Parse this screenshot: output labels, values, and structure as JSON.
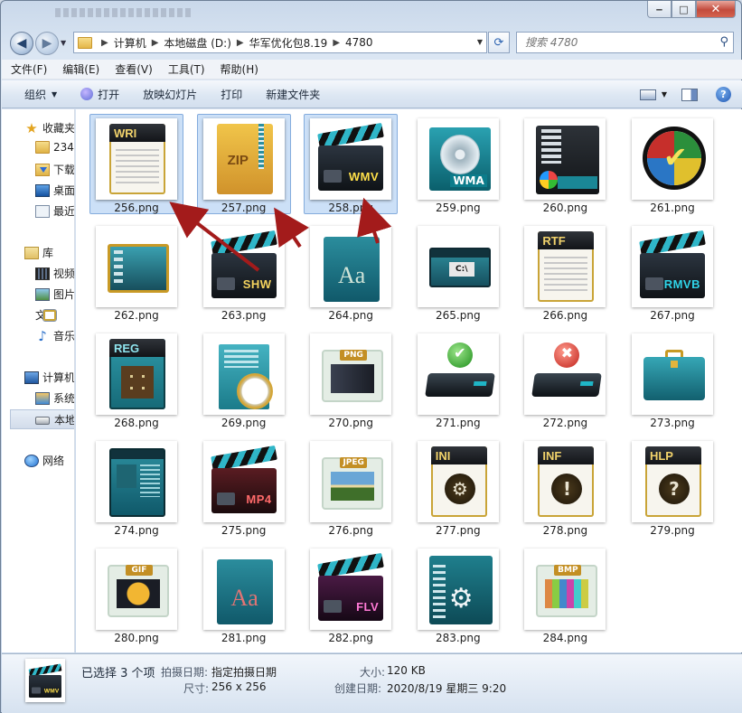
{
  "window": {
    "controls": {
      "minimize": "‒",
      "maximize": "□",
      "close": "✕"
    }
  },
  "address": {
    "crumbs": [
      "计算机",
      "本地磁盘 (D:)",
      "华军优化包8.19",
      "4780"
    ],
    "search_placeholder": "搜索 4780"
  },
  "menu": [
    "文件(F)",
    "编辑(E)",
    "查看(V)",
    "工具(T)",
    "帮助(H)"
  ],
  "toolbar": {
    "organize": "组织",
    "open": "打开",
    "slideshow": "放映幻灯片",
    "print": "打印",
    "new_folder": "新建文件夹"
  },
  "sidebar": {
    "favorites": "收藏夹",
    "fav_items": [
      "234",
      "下载",
      "桌面",
      "最近"
    ],
    "library": "库",
    "lib_items": [
      "视频",
      "图片",
      "文档",
      "音乐"
    ],
    "computer": "计算机",
    "comp_items": [
      "系统",
      "本地"
    ],
    "network": "网络"
  },
  "files": [
    {
      "name": "256.png",
      "icon": "wri-document-icon",
      "selected": true
    },
    {
      "name": "257.png",
      "icon": "zip-archive-icon",
      "selected": true
    },
    {
      "name": "258.png",
      "icon": "wmv-clapper-icon",
      "selected": true
    },
    {
      "name": "259.png",
      "icon": "wma-disc-icon",
      "selected": false
    },
    {
      "name": "260.png",
      "icon": "windows-panel-icon",
      "selected": false
    },
    {
      "name": "261.png",
      "icon": "checkmark-ball-icon",
      "selected": false
    },
    {
      "name": "262.png",
      "icon": "desktop-window-icon",
      "selected": false
    },
    {
      "name": "263.png",
      "icon": "shw-clapper-icon",
      "selected": false
    },
    {
      "name": "264.png",
      "icon": "font-file-icon",
      "selected": false
    },
    {
      "name": "265.png",
      "icon": "command-prompt-icon",
      "selected": false
    },
    {
      "name": "266.png",
      "icon": "rtf-document-icon",
      "selected": false
    },
    {
      "name": "267.png",
      "icon": "rmvb-clapper-icon",
      "selected": false
    },
    {
      "name": "268.png",
      "icon": "reg-document-icon",
      "selected": false
    },
    {
      "name": "269.png",
      "icon": "clock-document-icon",
      "selected": false
    },
    {
      "name": "270.png",
      "icon": "png-image-icon",
      "selected": false
    },
    {
      "name": "271.png",
      "icon": "drive-ok-icon",
      "selected": false
    },
    {
      "name": "272.png",
      "icon": "drive-error-icon",
      "selected": false
    },
    {
      "name": "273.png",
      "icon": "briefcase-icon",
      "selected": false
    },
    {
      "name": "274.png",
      "icon": "teal-document-icon",
      "selected": false
    },
    {
      "name": "275.png",
      "icon": "mp4-clapper-icon",
      "selected": false
    },
    {
      "name": "276.png",
      "icon": "jpeg-image-icon",
      "selected": false
    },
    {
      "name": "277.png",
      "icon": "ini-settings-icon",
      "selected": false
    },
    {
      "name": "278.png",
      "icon": "inf-info-icon",
      "selected": false
    },
    {
      "name": "279.png",
      "icon": "hlp-help-icon",
      "selected": false
    },
    {
      "name": "280.png",
      "icon": "gif-image-icon",
      "selected": false
    },
    {
      "name": "281.png",
      "icon": "font-file-red-icon",
      "selected": false
    },
    {
      "name": "282.png",
      "icon": "flv-clapper-icon",
      "selected": false
    },
    {
      "name": "283.png",
      "icon": "settings-panel-icon",
      "selected": false
    },
    {
      "name": "284.png",
      "icon": "bmp-image-icon",
      "selected": false
    }
  ],
  "labels": {
    "wri": "WRI",
    "zip": "ZIP",
    "wmv": "WMV",
    "wma": "WMA",
    "shw": "SHW",
    "aa": "Aa",
    "cmd": "C:\\",
    "rtf": "RTF",
    "rmvb": "RMVB",
    "reg": "REG",
    "png": "PNG",
    "mp4": "MP4",
    "jpeg": "JPEG",
    "ini": "INI",
    "inf": "INF",
    "hlp": "HLP",
    "gif": "GIF",
    "flv": "FLV",
    "bmp": "BMP"
  },
  "details": {
    "selected": "已选择 3 个项",
    "taken_label": "拍摄日期:",
    "taken_value": "指定拍摄日期",
    "size_label": "大小:",
    "size_value": "120 KB",
    "dims_label": "尺寸:",
    "dims_value": "256 x 256",
    "created_label": "创建日期:",
    "created_value": "2020/8/19 星期三 9:20"
  },
  "colors": {
    "selection_bg": "#cce0f7",
    "arrow": "#a31b1b",
    "teal": "#1b7b8a",
    "gold": "#c9a437"
  }
}
